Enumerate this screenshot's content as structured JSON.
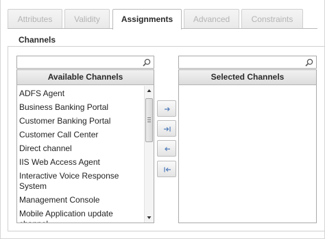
{
  "tabs": [
    {
      "label": "Attributes",
      "active": false
    },
    {
      "label": "Validity",
      "active": false
    },
    {
      "label": "Assignments",
      "active": true
    },
    {
      "label": "Advanced",
      "active": false
    },
    {
      "label": "Constraints",
      "active": false
    }
  ],
  "section": {
    "legend": "Channels"
  },
  "available": {
    "search_value": "",
    "header": "Available Channels",
    "items": [
      "ADFS Agent",
      "Business Banking Portal",
      "Customer Banking Portal",
      "Customer Call Center",
      "Direct channel",
      "IIS Web Access Agent",
      "Interactive Voice Response System",
      "Management Console",
      "Mobile Application update channel"
    ]
  },
  "selected": {
    "search_value": "",
    "header": "Selected Channels",
    "items": []
  },
  "buttons": [
    {
      "name": "move-selected-right-button",
      "icon": "arrow-right-icon"
    },
    {
      "name": "move-all-right-button",
      "icon": "arrow-right-bar-icon"
    },
    {
      "name": "move-selected-left-button",
      "icon": "arrow-left-icon"
    },
    {
      "name": "move-all-left-button",
      "icon": "arrow-left-bar-icon"
    }
  ],
  "colors": {
    "icon_blue": "#4a78b8",
    "active_tab_text": "#2a2a2a",
    "inactive_tab_text": "#b4b4b4"
  }
}
